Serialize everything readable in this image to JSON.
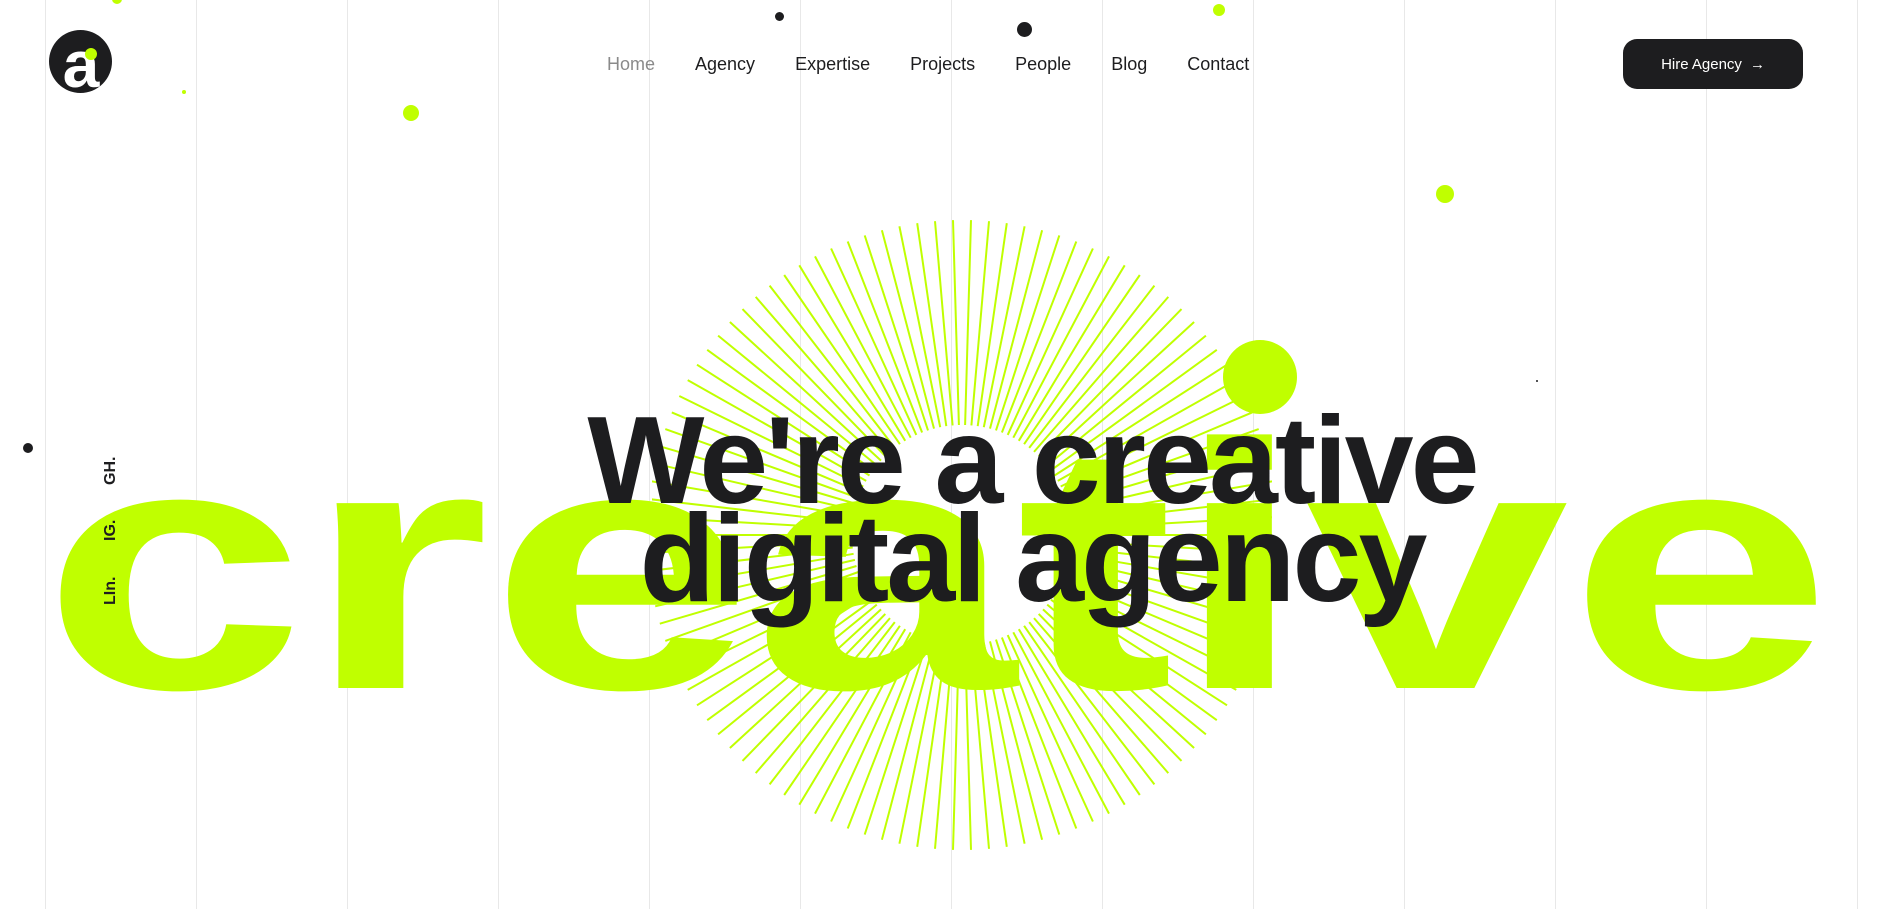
{
  "header": {
    "logo_letter": "a",
    "nav": [
      {
        "label": "Home",
        "active": true
      },
      {
        "label": "Agency",
        "active": false
      },
      {
        "label": "Expertise",
        "active": false
      },
      {
        "label": "Projects",
        "active": false
      },
      {
        "label": "People",
        "active": false
      },
      {
        "label": "Blog",
        "active": false
      },
      {
        "label": "Contact",
        "active": false
      }
    ],
    "cta_label": "Hire Agency",
    "cta_icon": "arrow-right-icon"
  },
  "socials": [
    {
      "label": "GH."
    },
    {
      "label": "IG."
    },
    {
      "label": "LIn."
    }
  ],
  "hero": {
    "background_word": "creative",
    "headline_line1": "We're a creative",
    "headline_line2": "digital agency"
  },
  "colors": {
    "accent": "#c0ff00",
    "dark": "#1d1d1f",
    "nav_active": "#8a8a8a",
    "grid": "#e8e8e8",
    "background": "#ffffff"
  }
}
